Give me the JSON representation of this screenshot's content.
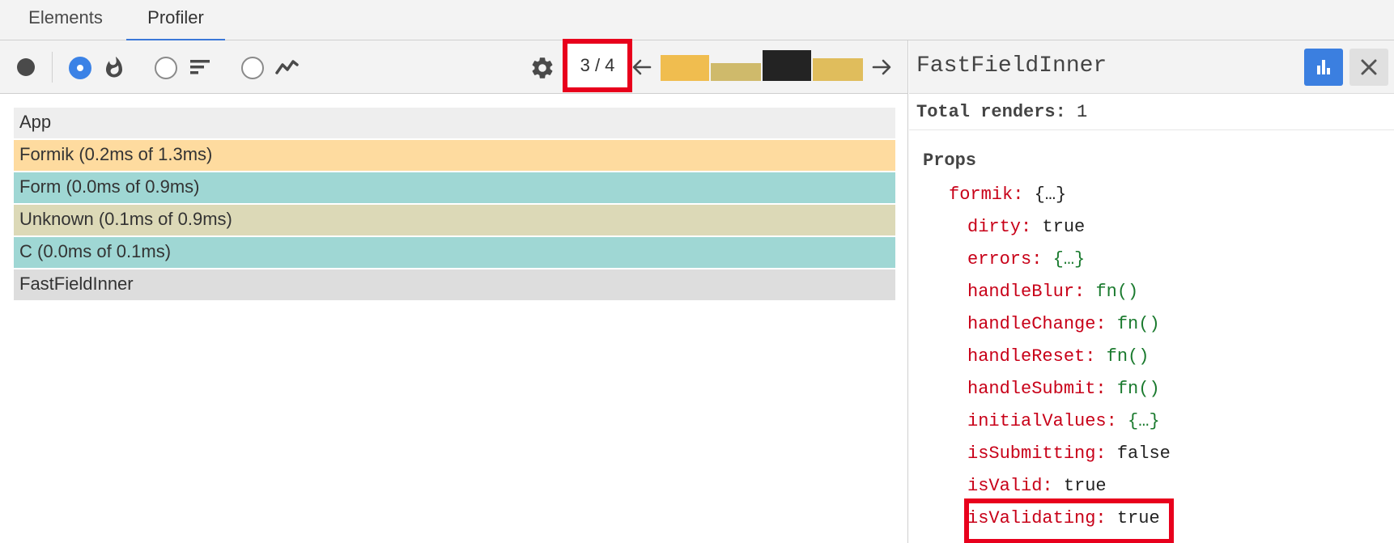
{
  "tabs": [
    {
      "label": "Elements",
      "active": false
    },
    {
      "label": "Profiler",
      "active": true
    }
  ],
  "toolbar": {
    "commit_counter": "3 / 4",
    "selected_view": "flame-chart",
    "commit_bar_colors": [
      "#f0bd4f",
      "#cfba6b",
      "#232323",
      "#e0bd5c"
    ]
  },
  "flame": {
    "rows": [
      {
        "label": "App",
        "color": "#eeeeee"
      },
      {
        "label": "Formik (0.2ms of 1.3ms)",
        "color": "#fedb9f"
      },
      {
        "label": "Form (0.0ms of 0.9ms)",
        "color": "#9fd7d4"
      },
      {
        "label": "Unknown (0.1ms of 0.9ms)",
        "color": "#dcd9b7"
      },
      {
        "label": "C (0.0ms of 0.1ms)",
        "color": "#9fd7d4"
      },
      {
        "label": "FastFieldInner",
        "color": "#dddddd"
      }
    ]
  },
  "sidepanel": {
    "title": "FastFieldInner",
    "total_renders_label": "Total renders:",
    "total_renders_value": "1",
    "props_label": "Props",
    "props": [
      {
        "key": "formik:",
        "value": "{…}",
        "green": false
      },
      {
        "key": "dirty:",
        "value": "true",
        "green": false
      },
      {
        "key": "errors:",
        "value": "{…}",
        "green": true
      },
      {
        "key": "handleBlur:",
        "value": "fn()",
        "green": true
      },
      {
        "key": "handleChange:",
        "value": "fn()",
        "green": true
      },
      {
        "key": "handleReset:",
        "value": "fn()",
        "green": true
      },
      {
        "key": "handleSubmit:",
        "value": "fn()",
        "green": true
      },
      {
        "key": "initialValues:",
        "value": "{…}",
        "green": true
      },
      {
        "key": "isSubmitting:",
        "value": "false",
        "green": false
      },
      {
        "key": "isValid:",
        "value": "true",
        "green": false
      },
      {
        "key": "isValidating:",
        "value": "true",
        "green": false
      }
    ]
  }
}
